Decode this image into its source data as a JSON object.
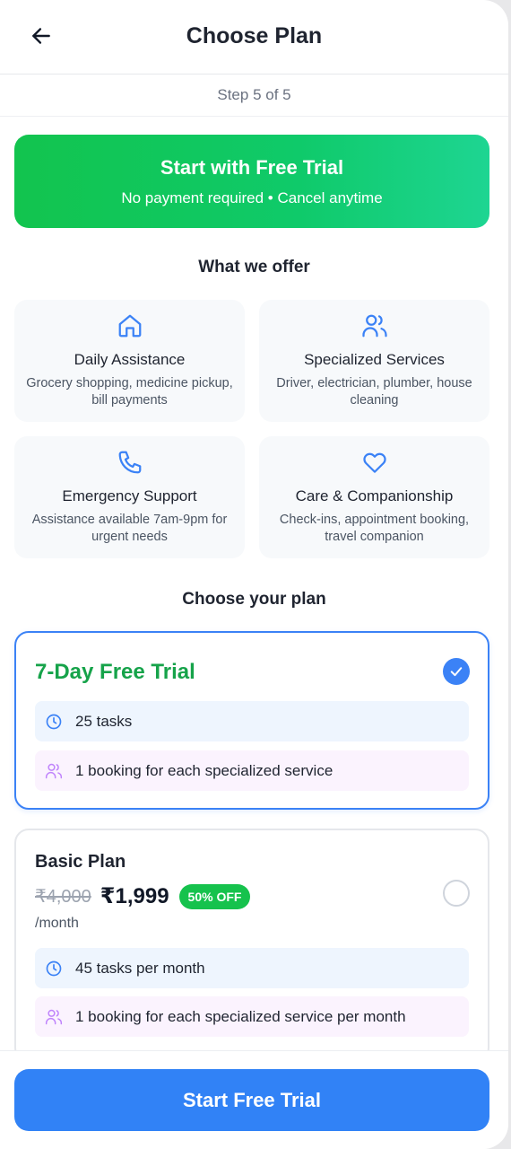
{
  "header": {
    "title": "Choose Plan",
    "back_icon": "arrow-left-icon"
  },
  "step": {
    "label": "Step 5 of 5"
  },
  "banner": {
    "title": "Start with Free Trial",
    "subtitle": "No payment required • Cancel anytime"
  },
  "offer": {
    "heading": "What we offer",
    "items": [
      {
        "icon": "home-icon",
        "title": "Daily Assistance",
        "desc": "Grocery shopping, medicine pickup, bill payments"
      },
      {
        "icon": "users-icon",
        "title": "Specialized Services",
        "desc": "Driver, electrician, plumber, house cleaning"
      },
      {
        "icon": "phone-icon",
        "title": "Emergency Support",
        "desc": "Assistance available 7am-9pm for urgent needs"
      },
      {
        "icon": "heart-icon",
        "title": "Care & Companionship",
        "desc": "Check-ins, appointment booking, travel companion"
      }
    ]
  },
  "plans": {
    "heading": "Choose your plan",
    "trial": {
      "name": "7-Day Free Trial",
      "selected": true,
      "perks": [
        {
          "icon": "clock-icon",
          "text": "25 tasks"
        },
        {
          "icon": "users-icon",
          "text": "1 booking for each specialized service"
        }
      ]
    },
    "basic": {
      "name": "Basic Plan",
      "old_price": "₹4,000",
      "price": "₹1,999",
      "discount": "50% OFF",
      "period": "/month",
      "selected": false,
      "perks": [
        {
          "icon": "clock-icon",
          "text": "45 tasks per month"
        },
        {
          "icon": "users-icon",
          "text": "1 booking for each specialized service per month"
        }
      ]
    }
  },
  "footer": {
    "cta_label": "Start Free Trial"
  },
  "colors": {
    "primary": "#3182f6",
    "success": "#16a34a",
    "banner_start": "#12c44e",
    "banner_end": "#1ed592",
    "icon_blue": "#3b82f6",
    "icon_purple": "#c084fc"
  }
}
